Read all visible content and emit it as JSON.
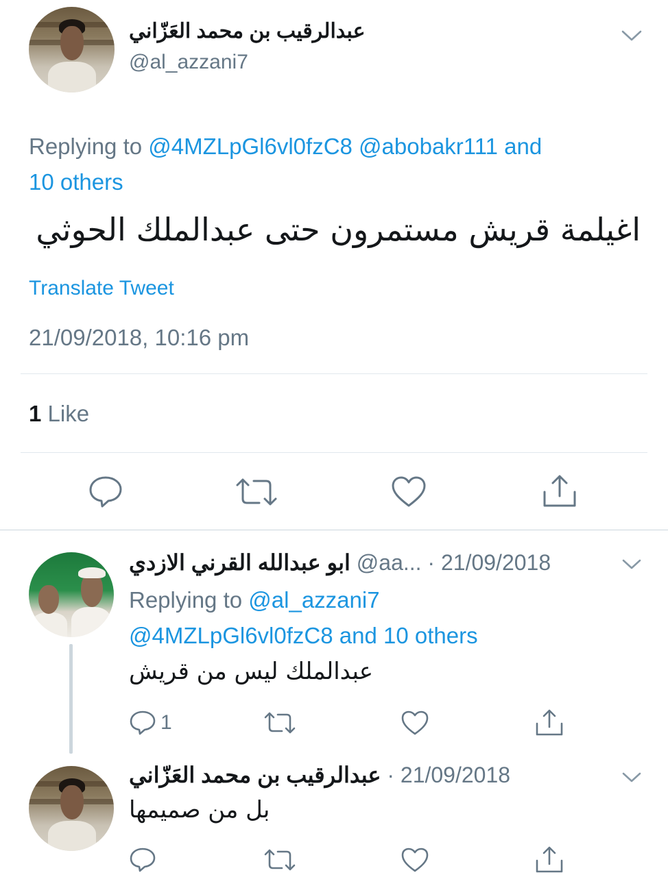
{
  "main_tweet": {
    "display_name": "عبدالرقيب بن محمد العَزّاني",
    "handle": "@al_azzani7",
    "replying_prefix": "Replying to",
    "replying_users_line1": "@4MZLpGl6vl0fzC8 @abobakr111 and",
    "replying_users_line2": "10 others",
    "text": "اغيلمة قريش مستمرون حتى عبدالملك الحوثي",
    "translate_label": "Translate Tweet",
    "timestamp": "21/09/2018, 10:16 pm",
    "like_count": "1",
    "like_label": "Like"
  },
  "reply1": {
    "display_name": "ابو عبدالله القرني الازدي",
    "handle": "@aa...",
    "date": "· 21/09/2018",
    "replying_prefix": "Replying to",
    "replying_user1": "@al_azzani7",
    "replying_users_line2": "@4MZLpGl6vl0fzC8 and 10 others",
    "text": "عبدالملك ليس من قريش",
    "reply_count": "1"
  },
  "reply2": {
    "display_name": "عبدالرقيب بن محمد العَزّاني",
    "date": "· 21/09/2018",
    "text": "بل من صميمها"
  },
  "colors": {
    "accent": "#1b95e0",
    "muted": "#657786",
    "text": "#14171a",
    "divider": "#e1e8ed"
  }
}
